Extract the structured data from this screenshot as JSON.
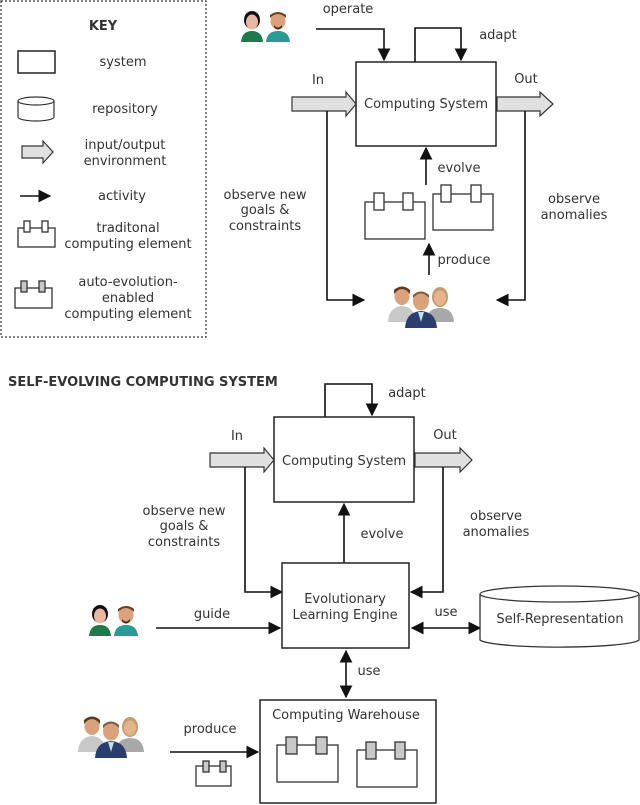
{
  "key": {
    "title": "KEY",
    "items": [
      {
        "icon": "system-rect-icon",
        "label_lines": [
          "system"
        ]
      },
      {
        "icon": "repository-cylinder-icon",
        "label_lines": [
          "repository"
        ]
      },
      {
        "icon": "io-arrow-icon",
        "label_lines": [
          "input/output",
          "environment"
        ]
      },
      {
        "icon": "activity-arrow-icon",
        "label_lines": [
          "activity"
        ]
      },
      {
        "icon": "traditional-element-icon",
        "label_lines": [
          "traditonal",
          "computing element"
        ]
      },
      {
        "icon": "auto-evolution-element-icon",
        "label_lines": [
          "auto-evolution-",
          "enabled",
          "computing element"
        ]
      }
    ]
  },
  "top": {
    "operate": "operate",
    "adapt": "adapt",
    "in": "In",
    "out": "Out",
    "system": "Computing System",
    "evolve": "evolve",
    "produce": "produce",
    "observe_goals": [
      "observe new",
      "goals &",
      "constraints"
    ],
    "observe_anomalies": [
      "observe",
      "anomalies"
    ]
  },
  "bottom": {
    "title": "SELF-EVOLVING COMPUTING SYSTEM",
    "adapt": "adapt",
    "in": "In",
    "out": "Out",
    "system": "Computing System",
    "evolve": "evolve",
    "observe_goals": [
      "observe new",
      "goals &",
      "constraints"
    ],
    "observe_anomalies": [
      "observe",
      "anomalies"
    ],
    "engine": [
      "Evolutionary",
      "Learning Engine"
    ],
    "guide": "guide",
    "use_repo": "use",
    "repository": "Self-Representation",
    "use_warehouse": "use",
    "warehouse": "Computing Warehouse",
    "produce": "produce"
  },
  "colors": {
    "io_fill": "#e0e0e0",
    "auto_tab_fill": "#c8c8c8",
    "operator_woman_shirt": "#1e7a4a",
    "operator_man_shirt": "#2a9a96",
    "developer_suit": "#2a3f6e"
  }
}
